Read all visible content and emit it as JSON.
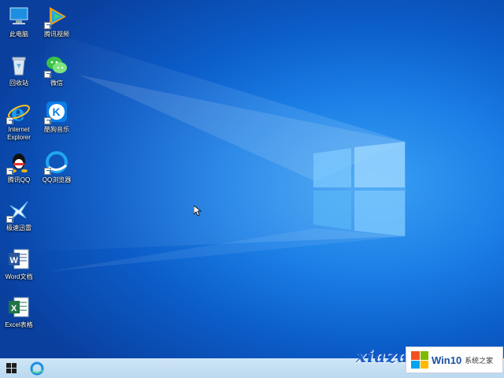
{
  "desktop": {
    "icons": [
      {
        "label": "此电脑",
        "icon": "this-pc-icon"
      },
      {
        "label": "腾讯视频",
        "icon": "tencent-video-icon"
      },
      {
        "label": "回收站",
        "icon": "recycle-bin-icon"
      },
      {
        "label": "微信",
        "icon": "wechat-icon"
      },
      {
        "label": "Internet Explorer",
        "icon": "internet-explorer-icon"
      },
      {
        "label": "酷狗音乐",
        "icon": "kugou-music-icon"
      },
      {
        "label": "腾讯QQ",
        "icon": "qq-icon"
      },
      {
        "label": "QQ浏览器",
        "icon": "qq-browser-icon"
      },
      {
        "label": "极速迅雷",
        "icon": "xunlei-icon"
      },
      {
        "label": "Word文档",
        "icon": "word-icon"
      },
      {
        "label": "Excel表格",
        "icon": "excel-icon"
      }
    ]
  },
  "watermark": {
    "text": "xiazai"
  },
  "brand": {
    "name": "Win10",
    "sub": "系统之家"
  },
  "taskbar": {
    "start": "start-icon",
    "browser": "edge-icon"
  },
  "colors": {
    "desktop": "#1b7fe6",
    "taskbar": "#c4dff3",
    "logo_red": "#f25022",
    "logo_green": "#7fba00",
    "logo_blue": "#00a4ef",
    "logo_yellow": "#ffb900"
  }
}
